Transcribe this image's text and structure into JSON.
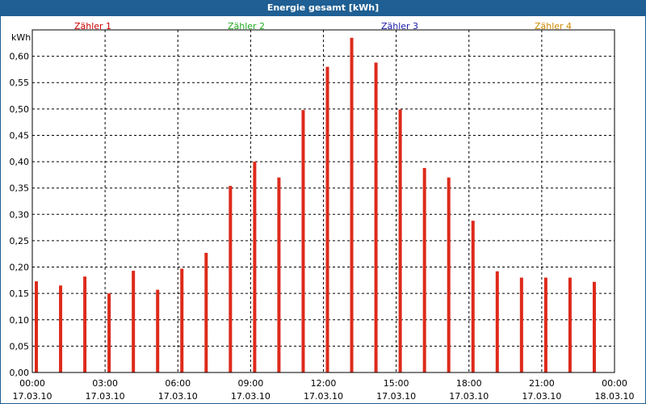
{
  "window": {
    "title": "Energie gesamt [kWh]"
  },
  "colors": {
    "titlebar": "#1f5f93",
    "bar": "#dd2a1b",
    "legend": [
      "#cc0000",
      "#22aa22",
      "#1a1aaa",
      "#cc8800"
    ]
  },
  "chart_data": {
    "type": "bar",
    "title": "Energie gesamt [kWh]",
    "ylabel": "kWh",
    "ylim": [
      0,
      0.65
    ],
    "yticks": [
      "0,00",
      "0,05",
      "0,10",
      "0,15",
      "0,20",
      "0,25",
      "0,30",
      "0,35",
      "0,40",
      "0,45",
      "0,50",
      "0,55",
      "0,60"
    ],
    "xticks": [
      {
        "time": "00:00",
        "date": "17.03.10"
      },
      {
        "time": "03:00",
        "date": "17.03.10"
      },
      {
        "time": "06:00",
        "date": "17.03.10"
      },
      {
        "time": "09:00",
        "date": "17.03.10"
      },
      {
        "time": "12:00",
        "date": "17.03.10"
      },
      {
        "time": "15:00",
        "date": "17.03.10"
      },
      {
        "time": "18:00",
        "date": "17.03.10"
      },
      {
        "time": "21:00",
        "date": "17.03.10"
      },
      {
        "time": "00:00",
        "date": "18.03.10"
      }
    ],
    "legend": [
      "Zähler 1",
      "Zähler 2",
      "Zähler 3",
      "Zähler 4"
    ],
    "grid": true,
    "categories": [
      "00:00",
      "01:00",
      "02:00",
      "03:00",
      "04:00",
      "05:00",
      "06:00",
      "07:00",
      "08:00",
      "09:00",
      "10:00",
      "11:00",
      "12:00",
      "13:00",
      "14:00",
      "15:00",
      "16:00",
      "17:00",
      "18:00",
      "19:00",
      "20:00",
      "21:00",
      "22:00",
      "23:00"
    ],
    "values": [
      0.173,
      0.165,
      0.182,
      0.15,
      0.193,
      0.157,
      0.197,
      0.227,
      0.354,
      0.4,
      0.37,
      0.498,
      0.58,
      0.635,
      0.588,
      0.499,
      0.388,
      0.37,
      0.288,
      0.192,
      0.18,
      0.18,
      0.18,
      0.172
    ]
  }
}
